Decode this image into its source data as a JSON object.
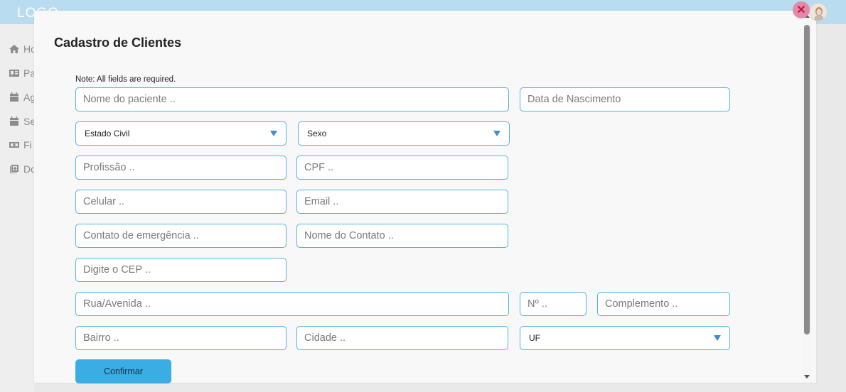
{
  "app": {
    "logo": "LOGO"
  },
  "sidebar": {
    "items": [
      {
        "label": "Ho",
        "icon": "home-icon"
      },
      {
        "label": "Pa",
        "icon": "id-card-icon"
      },
      {
        "label": "Ag",
        "icon": "calendar-icon"
      },
      {
        "label": "Se",
        "icon": "calendar-icon"
      },
      {
        "label": "Fi",
        "icon": "money-icon"
      },
      {
        "label": "Do",
        "icon": "documents-icon"
      }
    ]
  },
  "modal": {
    "title": "Cadastro de Clientes",
    "note": "Note: All fields are required.",
    "fields": {
      "nome": {
        "placeholder": "Nome do paciente .."
      },
      "nascimento": {
        "placeholder": "Data de Nascimento"
      },
      "estado_civil": {
        "value": "Estado Civil"
      },
      "sexo": {
        "value": "Sexo"
      },
      "profissao": {
        "placeholder": "Profissão .."
      },
      "cpf": {
        "placeholder": "CPF .."
      },
      "celular": {
        "placeholder": "Celular .."
      },
      "email": {
        "placeholder": "Email .."
      },
      "contato_emergencia": {
        "placeholder": "Contato de emergência .."
      },
      "nome_contato": {
        "placeholder": "Nome do Contato .."
      },
      "cep": {
        "placeholder": "Digite o CEP .."
      },
      "rua": {
        "placeholder": "Rua/Avenida .."
      },
      "numero": {
        "placeholder": "Nº .."
      },
      "complemento": {
        "placeholder": "Complemento .."
      },
      "bairro": {
        "placeholder": "Bairro .."
      },
      "cidade": {
        "placeholder": "Cidade .."
      },
      "uf": {
        "value": "UF"
      }
    },
    "confirm_label": "Confirmar",
    "close_icon": "close-icon"
  },
  "colors": {
    "accent": "#3aaee4",
    "border": "#4fb3e3",
    "topbar": "#b9dcf0"
  }
}
